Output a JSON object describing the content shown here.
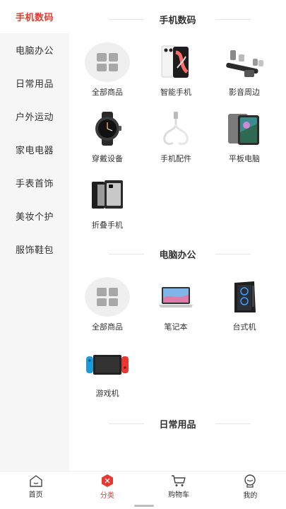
{
  "sidebar": {
    "items": [
      {
        "label": "手机数码"
      },
      {
        "label": "电脑办公"
      },
      {
        "label": "日常用品"
      },
      {
        "label": "户外运动"
      },
      {
        "label": "家电电器"
      },
      {
        "label": "手表首饰"
      },
      {
        "label": "美妆个护"
      },
      {
        "label": "服饰鞋包"
      }
    ],
    "active_index": 0
  },
  "sections": [
    {
      "title": "手机数码",
      "items": [
        {
          "label": "全部商品",
          "icon": "all-products-icon"
        },
        {
          "label": "智能手机",
          "icon": "smartphone-icon"
        },
        {
          "label": "影音周边",
          "icon": "audio-video-icon"
        },
        {
          "label": "穿戴设备",
          "icon": "smartwatch-icon"
        },
        {
          "label": "手机配件",
          "icon": "charging-cable-icon"
        },
        {
          "label": "平板电脑",
          "icon": "tablet-icon"
        },
        {
          "label": "折叠手机",
          "icon": "foldable-phone-icon"
        }
      ]
    },
    {
      "title": "电脑办公",
      "items": [
        {
          "label": "全部商品",
          "icon": "all-products-icon"
        },
        {
          "label": "笔记本",
          "icon": "laptop-icon"
        },
        {
          "label": "台式机",
          "icon": "desktop-pc-icon"
        },
        {
          "label": "游戏机",
          "icon": "game-console-icon"
        }
      ]
    },
    {
      "title": "日常用品",
      "items": []
    }
  ],
  "tabbar": {
    "tabs": [
      {
        "label": "首页",
        "icon": "home-icon"
      },
      {
        "label": "分类",
        "icon": "category-icon"
      },
      {
        "label": "购物车",
        "icon": "cart-icon"
      },
      {
        "label": "我的",
        "icon": "profile-icon"
      }
    ],
    "active_index": 1
  },
  "colors": {
    "accent": "#e8382f",
    "sidebar_bg": "#f6f6f6"
  }
}
